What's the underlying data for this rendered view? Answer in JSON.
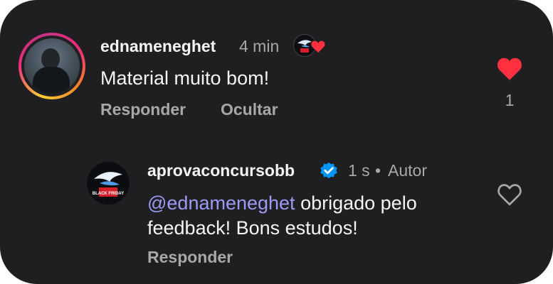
{
  "colors": {
    "card_bg": "#1f1f21",
    "text_primary": "#f5f5f5",
    "text_secondary": "#a8a8a8",
    "mention": "#9b9bf5",
    "like_red": "#ff3040",
    "verified_blue": "#0095f6"
  },
  "comment": {
    "username": "ednameneghet",
    "time": "4 min",
    "text": "Material muito bom!",
    "reply_label": "Responder",
    "hide_label": "Ocultar",
    "like_count": "1",
    "liked": true,
    "icons": {
      "avatar": "profile-photo",
      "creator_heart": "creator-liked-badge",
      "like": "heart-filled-icon"
    }
  },
  "reply": {
    "username": "aprovaconcursobb",
    "time": "1 s",
    "separator": "•",
    "author_label": "Autor",
    "mention": "@ednameneghet",
    "text_line1": "obrigado pelo",
    "text_line2": "feedback! Bons estudos!",
    "reply_label": "Responder",
    "liked": false,
    "badge_text": "BLACK FRIDAY",
    "icons": {
      "verified": "verified-badge-icon",
      "like": "heart-outline-icon"
    }
  }
}
